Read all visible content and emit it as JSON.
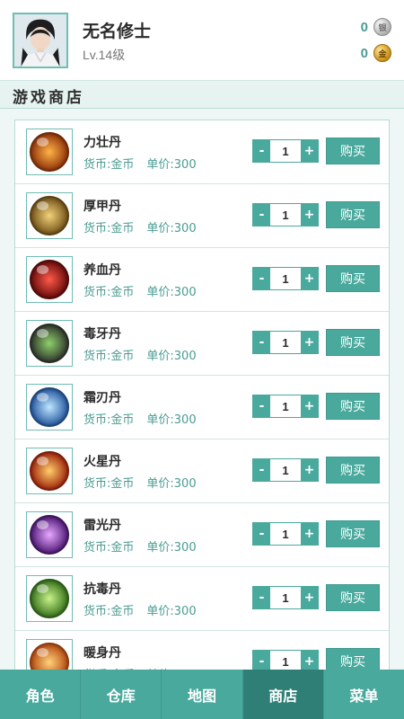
{
  "header": {
    "player_name": "无名修士",
    "level": "Lv.14级",
    "silver": "0",
    "gold": "0",
    "silver_coin_glyph": "银",
    "gold_coin_glyph": "金"
  },
  "section": {
    "title": "游戏商店"
  },
  "shop": {
    "currency_label": "货币:金币",
    "price_label": "单价:300",
    "buy_label": "购买",
    "minus": "-",
    "plus": "+",
    "items": [
      {
        "name": "力壮丹",
        "qty": "1",
        "icon": "fire-orb-icon",
        "color_inner": "#ffb347",
        "color_outer": "#8a2c06"
      },
      {
        "name": "厚甲丹",
        "qty": "1",
        "icon": "earth-orb-icon",
        "color_inner": "#f2d27a",
        "color_outer": "#6b4a12"
      },
      {
        "name": "养血丹",
        "qty": "1",
        "icon": "blood-orb-icon",
        "color_inner": "#ff5a4a",
        "color_outer": "#5e0606"
      },
      {
        "name": "毒牙丹",
        "qty": "1",
        "icon": "poison-orb-icon",
        "color_inner": "#8fd06b",
        "color_outer": "#2a2e2a"
      },
      {
        "name": "霜刃丹",
        "qty": "1",
        "icon": "frost-orb-icon",
        "color_inner": "#bfe6ff",
        "color_outer": "#1b4f9a"
      },
      {
        "name": "火星丹",
        "qty": "1",
        "icon": "flame-orb-icon",
        "color_inner": "#ffcf6a",
        "color_outer": "#9a1a06"
      },
      {
        "name": "雷光丹",
        "qty": "1",
        "icon": "thunder-orb-icon",
        "color_inner": "#e7a8ff",
        "color_outer": "#45106e"
      },
      {
        "name": "抗毒丹",
        "qty": "1",
        "icon": "antidote-orb-icon",
        "color_inner": "#c8f28a",
        "color_outer": "#2d6a14"
      },
      {
        "name": "暖身丹",
        "qty": "1",
        "icon": "warm-orb-icon",
        "color_inner": "#ffd27a",
        "color_outer": "#b0410a"
      }
    ]
  },
  "nav": {
    "items": [
      {
        "label": "角色",
        "active": false
      },
      {
        "label": "仓库",
        "active": false
      },
      {
        "label": "地图",
        "active": false
      },
      {
        "label": "商店",
        "active": true
      },
      {
        "label": "菜单",
        "active": false
      }
    ]
  },
  "colors": {
    "accent": "#4aa99d",
    "accent_dark": "#2f7f76",
    "meta_text": "#4a9c93"
  }
}
